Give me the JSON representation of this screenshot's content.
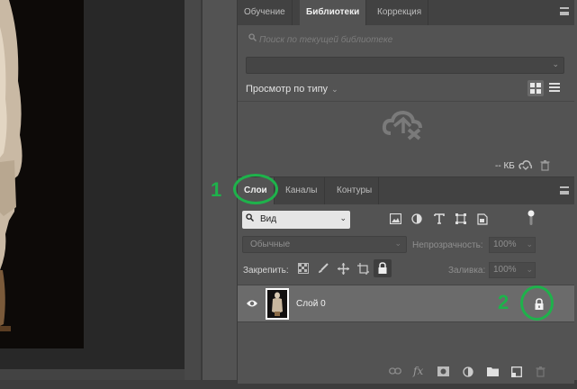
{
  "colors": {
    "panel_bg": "#535353",
    "tab_bg": "#424242",
    "selected_layer": "#6b6b6b",
    "annotation": "#1eb24b",
    "canvas_bg": "#282828"
  },
  "library": {
    "tabs": [
      "Обучение",
      "Библиотеки",
      "Коррекция"
    ],
    "active_tab": "Библиотеки",
    "search_placeholder": "Поиск по текущей библиотеке",
    "library_select_value": "",
    "view_by_label": "Просмотр по типу",
    "storage_size": "-- КБ",
    "icons": [
      "search-icon",
      "cloud-offline-icon",
      "grid-view-icon",
      "list-view-icon",
      "sync-icon",
      "trash-icon"
    ]
  },
  "layers": {
    "tabs": [
      "Слои",
      "Каналы",
      "Контуры"
    ],
    "active_tab": "Слои",
    "filter_value": "Вид",
    "blend_mode": "Обычные",
    "opacity_label": "Непрозрачность:",
    "opacity_value": "100%",
    "lock_label": "Закрепить:",
    "fill_label": "Заливка:",
    "fill_value": "100%",
    "layer_list": [
      {
        "name": "Слой 0",
        "visible": true,
        "locked": true,
        "selected": true
      }
    ],
    "footer_icons": [
      "link-icon",
      "fx-icon",
      "mask-icon",
      "adjustment-icon",
      "folder-icon",
      "new-layer-icon",
      "trash-icon"
    ]
  },
  "annotations": {
    "num1": "1",
    "num2": "2"
  }
}
